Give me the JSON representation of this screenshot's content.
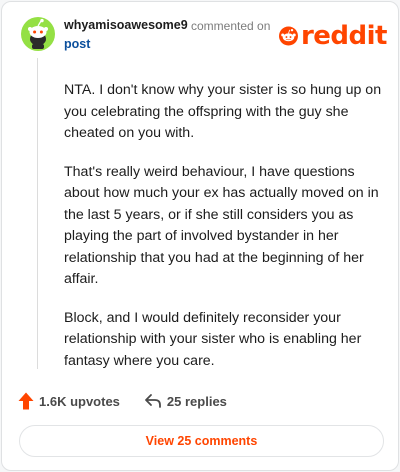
{
  "header": {
    "username": "whyamisoawesome9",
    "commented_on": "commented on",
    "post_link": "post",
    "brand": "reddit"
  },
  "comment": {
    "paragraphs": [
      "NTA. I don't know why your sister is so hung up on you celebrating the offspring with the guy she cheated on you with.",
      "That's really weird behaviour, I have questions about how much your ex has actually moved on in the last 5 years, or if she still considers you as playing the part of involved bystander in her relationship that you had at the beginning of her affair.",
      "Block, and I would definitely reconsider your relationship with your sister who is enabling her fantasy where you care."
    ]
  },
  "actions": {
    "upvotes": "1.6K upvotes",
    "replies": "25 replies"
  },
  "footer": {
    "view_comments": "View 25 comments"
  },
  "colors": {
    "brand": "#ff4500",
    "avatar_bg": "#94e044",
    "link": "#0b4f9c"
  },
  "icons": {
    "avatar": "snoo-avatar-icon",
    "logo": "reddit-snoo-logo-icon",
    "upvote": "upvote-arrow-icon",
    "reply": "reply-arrow-icon"
  }
}
